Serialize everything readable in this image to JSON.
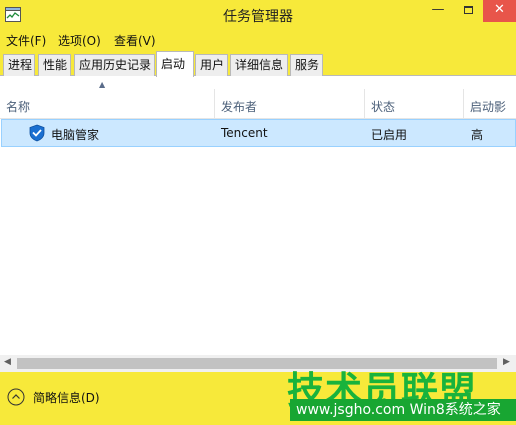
{
  "window": {
    "title": "任务管理器",
    "minimize_glyph": "—",
    "close_glyph": "✕",
    "accent_color": "#f7e93a",
    "close_color": "#e8554a"
  },
  "menu": {
    "file": "文件(F)",
    "options": "选项(O)",
    "view": "查看(V)"
  },
  "tabs": [
    {
      "label": "进程"
    },
    {
      "label": "性能"
    },
    {
      "label": "应用历史记录"
    },
    {
      "label": "启动",
      "active": true
    },
    {
      "label": "用户"
    },
    {
      "label": "详细信息"
    },
    {
      "label": "服务"
    }
  ],
  "columns": {
    "name": "名称",
    "publisher": "发布者",
    "status": "状态",
    "impact": "启动影"
  },
  "sort_glyph": "▲",
  "rows": [
    {
      "name": "电脑管家",
      "publisher": "Tencent",
      "status": "已启用",
      "impact": "高",
      "icon": "shield-icon"
    }
  ],
  "scrollbar": {
    "left_glyph": "◀",
    "right_glyph": "▶"
  },
  "footer": {
    "fewer_details": "简略信息(D)"
  },
  "watermark": {
    "logo_text": "技术员联盟",
    "url_text": "www.jsgho.com  Win8系统之家"
  },
  "selection_color": "#cce8ff"
}
